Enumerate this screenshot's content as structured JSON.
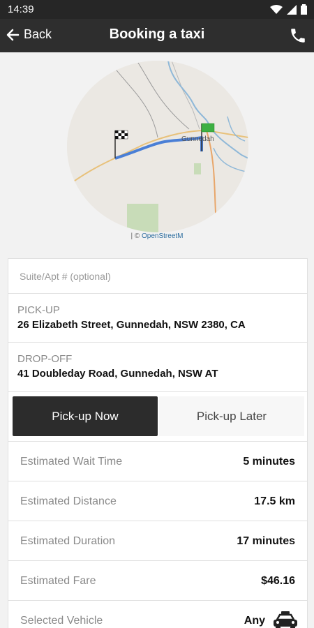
{
  "status_bar": {
    "time": "14:39"
  },
  "app_bar": {
    "back_label": "Back",
    "title": "Booking a taxi"
  },
  "map": {
    "attribution_prefix": "| ©",
    "attribution_link": "OpenStreetM",
    "town_label": "Gunnedah"
  },
  "form": {
    "suite_placeholder": "Suite/Apt # (optional)",
    "pickup_label": "PICK-UP",
    "pickup_address": "26 Elizabeth Street, Gunnedah, NSW 2380, CA",
    "dropoff_label": "DROP-OFF",
    "dropoff_address": "41 Doubleday Road, Gunnedah, NSW AT"
  },
  "toggle": {
    "now_label": "Pick-up Now",
    "later_label": "Pick-up Later",
    "selected": "now"
  },
  "estimates": {
    "wait_label": "Estimated Wait Time",
    "wait_value": "5 minutes",
    "distance_label": "Estimated Distance",
    "distance_value": "17.5 km",
    "duration_label": "Estimated Duration",
    "duration_value": "17 minutes",
    "fare_label": "Estimated Fare",
    "fare_value": "$46.16",
    "vehicle_label": "Selected Vehicle",
    "vehicle_value": "Any"
  },
  "colors": {
    "app_bar": "#2e2e2e",
    "route": "#4a7fd6",
    "dropoff_flag": "#3cb043"
  }
}
